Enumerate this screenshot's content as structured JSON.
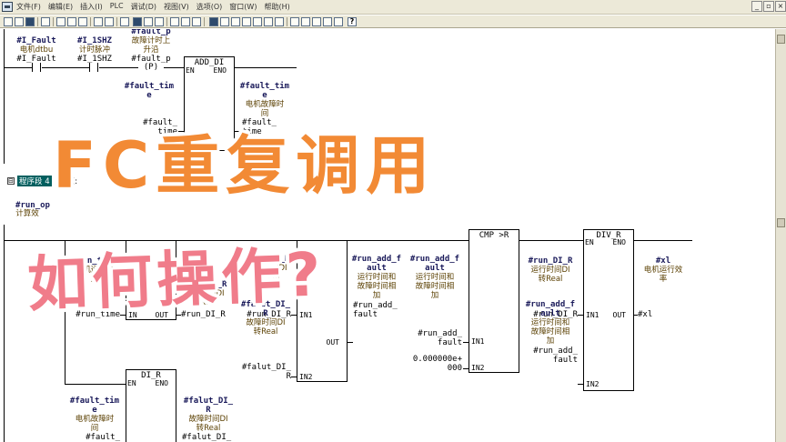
{
  "menu": {
    "items": [
      "文件(F)",
      "编辑(E)",
      "插入(I)",
      "PLC",
      "调试(D)",
      "视图(V)",
      "选项(O)",
      "窗口(W)",
      "帮助(H)"
    ],
    "window_minimize": "_",
    "window_restore": "▫",
    "window_close": "×"
  },
  "toolbar": {
    "help_glyph": "?"
  },
  "network1": {
    "contact1": {
      "var": "#I_Fault",
      "comment": "电机dtbu",
      "addr": "#I_Fault"
    },
    "contact2": {
      "var": "#I_1SHZ",
      "comment": "计时脉冲",
      "addr": "#I_1SHZ"
    },
    "edge": {
      "var_partial": "#fault_p",
      "comment_line1": "故障计时上",
      "comment_line2": "升沿",
      "addr": "#fault_p",
      "coil": "(P)"
    },
    "add_block": {
      "title": "ADD_DI",
      "en": "EN",
      "eno": "ENO",
      "in1_var_line1": "#fault_tim",
      "in1_var_line2": "e",
      "in1_addr_line1": "#fault_",
      "in1_addr_line2": "time",
      "out_var_line1": "#fault_tim",
      "out_var_line2": "e",
      "out_cmt_line1": "电机故障时",
      "out_cmt_line2": "间",
      "out_addr_line1": "#fault_",
      "out_addr_line2": "time"
    }
  },
  "network2": {
    "header": {
      "collapse": "⊟",
      "tag": "程序段 4",
      "title": ": 标题:"
    },
    "run_op": {
      "var": "#run_op",
      "comment": "计算效"
    },
    "di_r_top": {
      "in_var_line1": "#run_time",
      "in_cmt_line1": "电机运动时",
      "in_cmt_line2": "间",
      "in_addr": "#run_time",
      "in_pin": "IN",
      "out_pin": "OUT",
      "out_var": "#run_DI_R",
      "out_cmt": "运行时间DI",
      "out_cmt2": "转Real",
      "out_addr": "#run_DI_R"
    },
    "add_r": {
      "in1_var": "#run_DI_R",
      "in1_cmt": "运行时间DI",
      "in1_cmt2": "转Real",
      "in1_addr": "#run_DI_R",
      "in1_pin": "IN1",
      "in2_var_line1": "#falut_DI_",
      "in2_var_line2": "R",
      "in2_cmt_line1": "故障时间DI",
      "in2_cmt_line2": "转Real",
      "in2_addr_line1": "#falut_DI_",
      "in2_addr_line2": "R",
      "in2_pin": "IN2",
      "out_pin": "OUT",
      "out_var_line1": "#run_add_f",
      "out_var_line2": "ault",
      "out_cmt_line1": "运行时间和",
      "out_cmt_line2": "故障时间相",
      "out_cmt_line3": "加",
      "out_addr_line1": "#run_add_",
      "out_addr_line2": "fault"
    },
    "cmp": {
      "title": "CMP >R",
      "in1_var_line1": "#run_add_f",
      "in1_var_line2": "ault",
      "in1_cmt_line1": "运行时间和",
      "in1_cmt_line2": "故障时间相",
      "in1_cmt_line3": "加",
      "in1_addr_line1": "#run_add_",
      "in1_addr_line2": "fault",
      "in1_pin": "IN1",
      "in2_const": "0.000000e+",
      "in2_const2": "000",
      "in2_pin": "IN2"
    },
    "div": {
      "title": "DIV_R",
      "en": "EN",
      "eno": "ENO",
      "in1_var": "#run_DI_R",
      "in1_cmt": "运行时间DI",
      "in1_cmt2": "转Real",
      "in1_addr": "#run_DI_R",
      "in1_pin": "IN1",
      "in2_var_line1": "#run_add_f",
      "in2_var_line2": "ault",
      "in2_cmt_line1": "运行时间和",
      "in2_cmt_line2": "故障时间相",
      "in2_cmt_line3": "加",
      "in2_addr_line1": "#run_add_",
      "in2_addr_line2": "fault",
      "in2_pin": "IN2",
      "out_pin": "OUT",
      "out_var": "#xl",
      "out_cmt_line1": "电机运行效",
      "out_cmt_line2": "率",
      "out_addr": "#xl"
    },
    "di_r_bottom": {
      "title": "DI_R",
      "en": "EN",
      "eno": "ENO",
      "in_var_line1": "#fault_tim",
      "in_var_line2": "e",
      "in_cmt_line1": "电机故障时",
      "in_cmt_line2": "间",
      "in_addr": "#fault_",
      "out_var_line1": "#falut_DI_",
      "out_var_line2": "R",
      "out_cmt_line1": "故障时间DI",
      "out_cmt_line2": "转Real",
      "out_addr": "#falut_DI_"
    }
  },
  "overlay": {
    "line1": "FC重复调用",
    "line2": "如何操作?"
  }
}
